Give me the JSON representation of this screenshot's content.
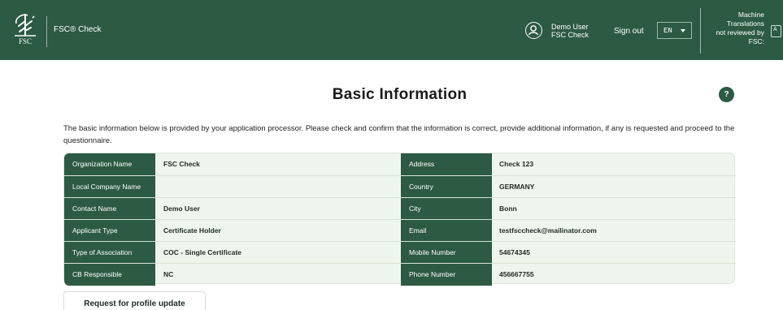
{
  "header": {
    "logo_text": "FSC",
    "app_title": "FSC® Check",
    "user_name": "Demo User",
    "user_org": "FSC Check",
    "sign_out": "Sign out",
    "language": "EN",
    "machine_line1": "Machine",
    "machine_line2": "Translations",
    "machine_line3": "not reviewed by",
    "machine_line4": "FSC:"
  },
  "page": {
    "title": "Basic Information",
    "help": "?",
    "intro": "The basic information below is provided by your application processor. Please check and confirm that the information is correct, provide additional information, if any is requested and proceed to the questionnaire."
  },
  "info": {
    "rows": [
      {
        "label1": "Organization Name",
        "value1": "FSC Check",
        "label2": "Address",
        "value2": "Check 123"
      },
      {
        "label1": "Local Company Name",
        "value1": "",
        "label2": "Country",
        "value2": "GERMANY"
      },
      {
        "label1": "Contact Name",
        "value1": "Demo User",
        "label2": "City",
        "value2": "Bonn"
      },
      {
        "label1": "Applicant Type",
        "value1": "Certificate Holder",
        "label2": "Email",
        "value2": "testfsccheck@mailinator.com"
      },
      {
        "label1": "Type of Association",
        "value1": "COC - Single Certificate",
        "label2": "Mobile Number",
        "value2": "54674345"
      },
      {
        "label1": "CB Responsible",
        "value1": "NC",
        "label2": "Phone Number",
        "value2": "456667755"
      }
    ]
  },
  "actions": {
    "request_profile_update": "Request for profile update"
  },
  "colors": {
    "brand_green": "#2c5a43",
    "card_bg": "#edf5ec"
  },
  "icons": [
    "fsc-tree-logo-icon",
    "user-circle-icon",
    "chevron-down-icon",
    "help-icon",
    "translate-icon"
  ]
}
